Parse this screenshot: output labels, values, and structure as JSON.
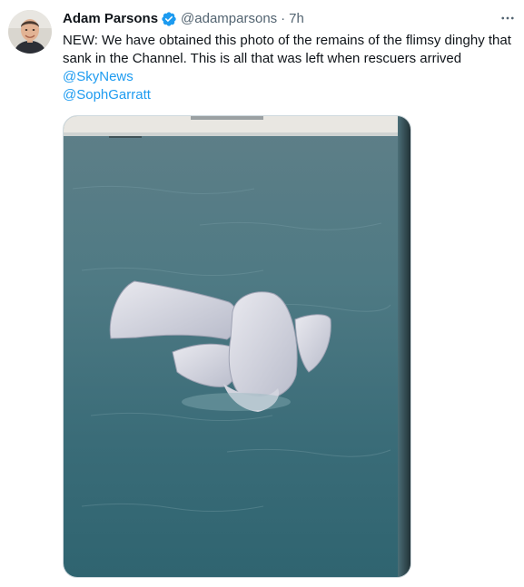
{
  "author": {
    "name": "Adam Parsons",
    "handle": "@adamparsons",
    "separator": "·",
    "time": "7h",
    "verified": true,
    "avatar_icon": "avatar-photo"
  },
  "tweet": {
    "text": "NEW: We have obtained this photo of the remains of the flimsy dinghy that sank in the Channel. This is all that was left when rescuers arrived",
    "mentions": [
      "@SkyNews",
      "@SophGarratt"
    ]
  },
  "media": {
    "description_icon": "sea-photo"
  },
  "colors": {
    "link": "#1d9bf0",
    "secondary_text": "#536471",
    "verified_badge": "#1d9bf0",
    "sea": "#3e6f7a"
  },
  "icons": {
    "more": "more-options-icon",
    "verified": "verified-badge-icon"
  }
}
